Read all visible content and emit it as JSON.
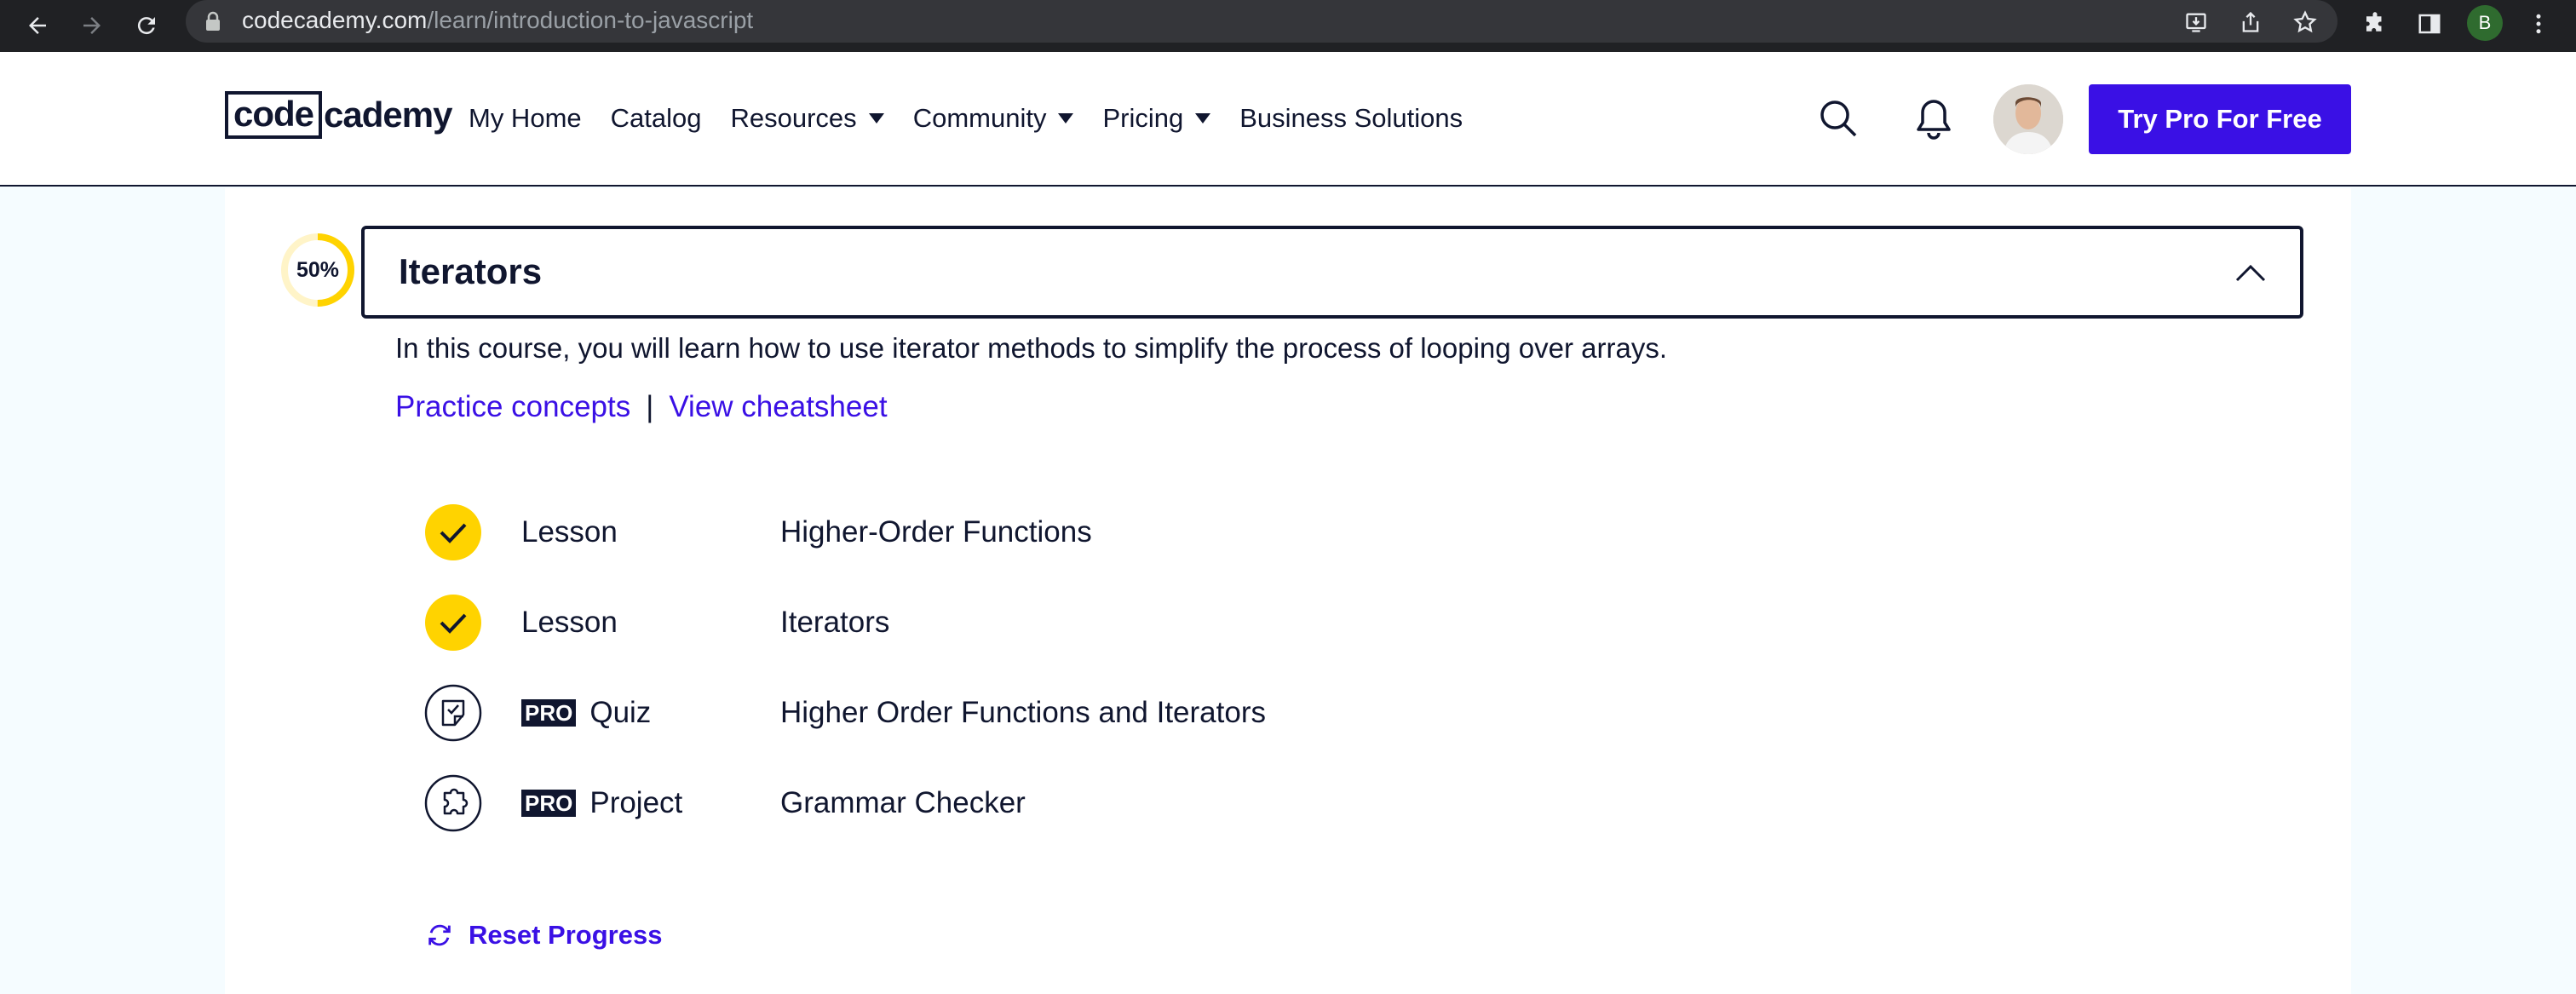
{
  "browser": {
    "url_host": "codecademy.com",
    "url_path": "/learn/introduction-to-javascript",
    "profile_initial": "B"
  },
  "header": {
    "logo_boxed": "code",
    "logo_rest": "cademy",
    "nav": [
      {
        "label": "My Home",
        "dropdown": false
      },
      {
        "label": "Catalog",
        "dropdown": false
      },
      {
        "label": "Resources",
        "dropdown": true
      },
      {
        "label": "Community",
        "dropdown": true
      },
      {
        "label": "Pricing",
        "dropdown": true
      },
      {
        "label": "Business Solutions",
        "dropdown": false
      }
    ],
    "cta_label": "Try Pro For Free"
  },
  "module": {
    "progress_label": "50%",
    "progress_value": 0.5,
    "title": "Iterators",
    "description": "In this course, you will learn how to use iterator methods to simplify the process of looping over arrays.",
    "links": {
      "practice": "Practice concepts",
      "separator": "|",
      "cheatsheet": "View cheatsheet"
    },
    "items": [
      {
        "status": "completed",
        "icon": "check-circle-icon",
        "pro": false,
        "pro_label": "",
        "type": "Lesson",
        "name": "Higher-Order Functions"
      },
      {
        "status": "completed",
        "icon": "check-circle-icon",
        "pro": false,
        "pro_label": "",
        "type": "Lesson",
        "name": "Iterators"
      },
      {
        "status": "locked",
        "icon": "quiz-icon",
        "pro": true,
        "pro_label": "PRO",
        "type": "Quiz",
        "name": "Higher Order Functions and Iterators"
      },
      {
        "status": "locked",
        "icon": "project-icon",
        "pro": true,
        "pro_label": "PRO",
        "type": "Project",
        "name": "Grammar Checker"
      }
    ],
    "reset_label": "Reset Progress"
  },
  "colors": {
    "brand_blue": "#3a10e5",
    "navy": "#10162f",
    "complete_yellow": "#ffd300",
    "page_bg": "#f5fcff"
  }
}
